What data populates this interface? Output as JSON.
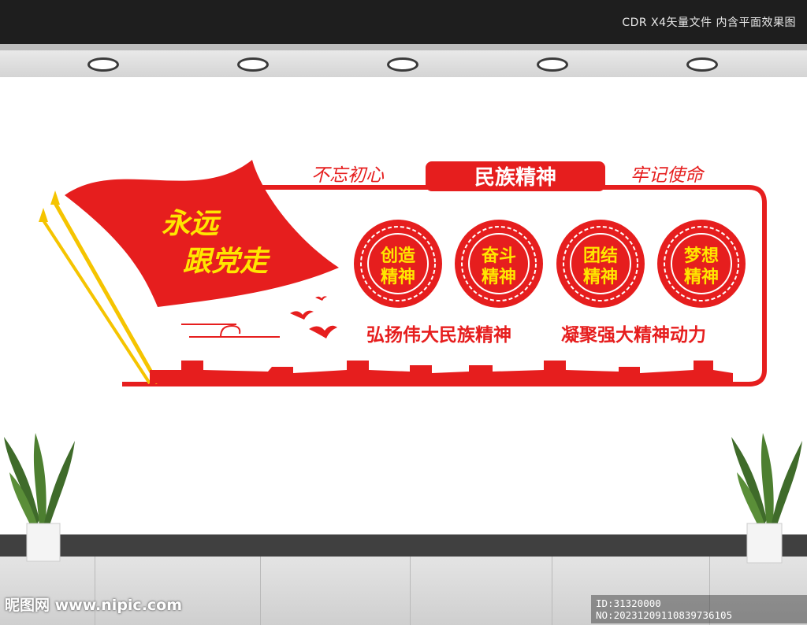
{
  "topbar": {
    "caption": "CDR X4矢量文件  内含平面效果图"
  },
  "flag": {
    "line1": "永远",
    "line2": "跟党走"
  },
  "header": {
    "left_slogan": "不忘初心",
    "center_title": "民族精神",
    "right_slogan": "牢记使命"
  },
  "circles": [
    {
      "line1": "创造",
      "line2": "精神"
    },
    {
      "line1": "奋斗",
      "line2": "精神"
    },
    {
      "line1": "团结",
      "line2": "精神"
    },
    {
      "line1": "梦想",
      "line2": "精神"
    }
  ],
  "slogans": {
    "left": "弘扬伟大民族精神",
    "right": "凝聚强大精神动力"
  },
  "watermark": {
    "left": "昵图网 www.nipic.com",
    "right": "ID:31320000 NO:20231209110839736105"
  },
  "colors": {
    "brand_red": "#e61e1e",
    "accent_yellow": "#ffe600"
  }
}
